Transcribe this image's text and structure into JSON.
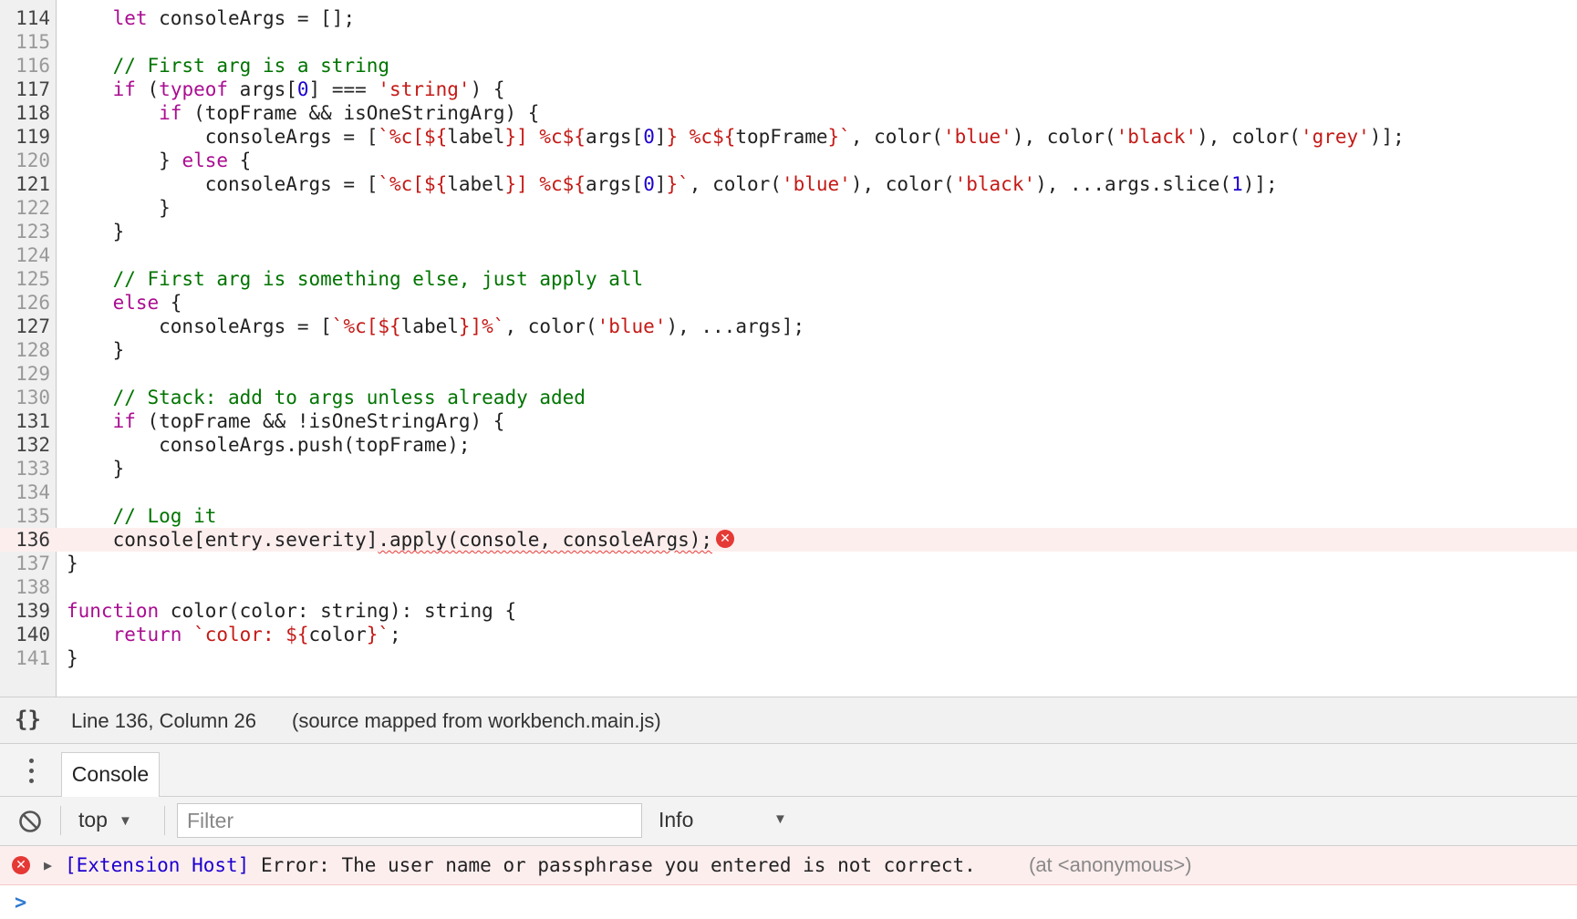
{
  "editor": {
    "current_line": "136",
    "lines": [
      {
        "n": "114",
        "dark": true,
        "t": [
          {
            "c": "",
            "s": "    "
          },
          {
            "c": "kw",
            "s": "let"
          },
          {
            "c": "",
            "s": " consoleArgs = [];"
          }
        ]
      },
      {
        "n": "115",
        "t": []
      },
      {
        "n": "116",
        "t": [
          {
            "c": "",
            "s": "    "
          },
          {
            "c": "cm",
            "s": "// First arg is a string"
          }
        ]
      },
      {
        "n": "117",
        "dark": true,
        "t": [
          {
            "c": "",
            "s": "    "
          },
          {
            "c": "kw",
            "s": "if"
          },
          {
            "c": "",
            "s": " ("
          },
          {
            "c": "kw",
            "s": "typeof"
          },
          {
            "c": "",
            "s": " args["
          },
          {
            "c": "num",
            "s": "0"
          },
          {
            "c": "",
            "s": "] === "
          },
          {
            "c": "str",
            "s": "'string'"
          },
          {
            "c": "",
            "s": ") {"
          }
        ]
      },
      {
        "n": "118",
        "dark": true,
        "t": [
          {
            "c": "",
            "s": "        "
          },
          {
            "c": "kw",
            "s": "if"
          },
          {
            "c": "",
            "s": " (topFrame && isOneStringArg) {"
          }
        ]
      },
      {
        "n": "119",
        "dark": true,
        "t": [
          {
            "c": "",
            "s": "            consoleArgs = ["
          },
          {
            "c": "str",
            "s": "`%c[${"
          },
          {
            "c": "",
            "s": "label"
          },
          {
            "c": "str",
            "s": "}] %c${"
          },
          {
            "c": "",
            "s": "args["
          },
          {
            "c": "num",
            "s": "0"
          },
          {
            "c": "",
            "s": "]"
          },
          {
            "c": "str",
            "s": "} %c${"
          },
          {
            "c": "",
            "s": "topFrame"
          },
          {
            "c": "str",
            "s": "}`"
          },
          {
            "c": "",
            "s": ", color("
          },
          {
            "c": "str",
            "s": "'blue'"
          },
          {
            "c": "",
            "s": "), color("
          },
          {
            "c": "str",
            "s": "'black'"
          },
          {
            "c": "",
            "s": "), color("
          },
          {
            "c": "str",
            "s": "'grey'"
          },
          {
            "c": "",
            "s": ")];"
          }
        ]
      },
      {
        "n": "120",
        "t": [
          {
            "c": "",
            "s": "        } "
          },
          {
            "c": "kw",
            "s": "else"
          },
          {
            "c": "",
            "s": " {"
          }
        ]
      },
      {
        "n": "121",
        "dark": true,
        "t": [
          {
            "c": "",
            "s": "            consoleArgs = ["
          },
          {
            "c": "str",
            "s": "`%c[${"
          },
          {
            "c": "",
            "s": "label"
          },
          {
            "c": "str",
            "s": "}] %c${"
          },
          {
            "c": "",
            "s": "args["
          },
          {
            "c": "num",
            "s": "0"
          },
          {
            "c": "",
            "s": "]"
          },
          {
            "c": "str",
            "s": "}`"
          },
          {
            "c": "",
            "s": ", color("
          },
          {
            "c": "str",
            "s": "'blue'"
          },
          {
            "c": "",
            "s": "), color("
          },
          {
            "c": "str",
            "s": "'black'"
          },
          {
            "c": "",
            "s": "), ...args.slice("
          },
          {
            "c": "num",
            "s": "1"
          },
          {
            "c": "",
            "s": ")];"
          }
        ]
      },
      {
        "n": "122",
        "t": [
          {
            "c": "",
            "s": "        }"
          }
        ]
      },
      {
        "n": "123",
        "t": [
          {
            "c": "",
            "s": "    }"
          }
        ]
      },
      {
        "n": "124",
        "t": []
      },
      {
        "n": "125",
        "t": [
          {
            "c": "",
            "s": "    "
          },
          {
            "c": "cm",
            "s": "// First arg is something else, just apply all"
          }
        ]
      },
      {
        "n": "126",
        "t": [
          {
            "c": "",
            "s": "    "
          },
          {
            "c": "kw",
            "s": "else"
          },
          {
            "c": "",
            "s": " {"
          }
        ]
      },
      {
        "n": "127",
        "dark": true,
        "t": [
          {
            "c": "",
            "s": "        consoleArgs = ["
          },
          {
            "c": "str",
            "s": "`%c[${"
          },
          {
            "c": "",
            "s": "label"
          },
          {
            "c": "str",
            "s": "}]%`"
          },
          {
            "c": "",
            "s": ", color("
          },
          {
            "c": "str",
            "s": "'blue'"
          },
          {
            "c": "",
            "s": "), ...args];"
          }
        ]
      },
      {
        "n": "128",
        "t": [
          {
            "c": "",
            "s": "    }"
          }
        ]
      },
      {
        "n": "129",
        "t": []
      },
      {
        "n": "130",
        "t": [
          {
            "c": "",
            "s": "    "
          },
          {
            "c": "cm",
            "s": "// Stack: add to args unless already aded"
          }
        ]
      },
      {
        "n": "131",
        "dark": true,
        "t": [
          {
            "c": "",
            "s": "    "
          },
          {
            "c": "kw",
            "s": "if"
          },
          {
            "c": "",
            "s": " (topFrame && !isOneStringArg) {"
          }
        ]
      },
      {
        "n": "132",
        "dark": true,
        "t": [
          {
            "c": "",
            "s": "        consoleArgs.push(topFrame);"
          }
        ]
      },
      {
        "n": "133",
        "t": [
          {
            "c": "",
            "s": "    }"
          }
        ]
      },
      {
        "n": "134",
        "t": []
      },
      {
        "n": "135",
        "t": [
          {
            "c": "",
            "s": "    "
          },
          {
            "c": "cm",
            "s": "// Log it"
          }
        ]
      },
      {
        "n": "136",
        "dark": true,
        "current": true,
        "error": true,
        "t": [
          {
            "c": "",
            "s": "    console[entry.severity]"
          },
          {
            "c": "squig",
            "s": ".apply(console, consoleArgs);"
          }
        ]
      },
      {
        "n": "137",
        "t": [
          {
            "c": "",
            "s": "}"
          }
        ]
      },
      {
        "n": "138",
        "t": []
      },
      {
        "n": "139",
        "dark": true,
        "t": [
          {
            "c": "kw",
            "s": "function"
          },
          {
            "c": "",
            "s": " color(color: string): string {"
          }
        ]
      },
      {
        "n": "140",
        "dark": true,
        "t": [
          {
            "c": "",
            "s": "    "
          },
          {
            "c": "kw",
            "s": "return"
          },
          {
            "c": "",
            "s": " "
          },
          {
            "c": "str",
            "s": "`color: ${"
          },
          {
            "c": "",
            "s": "color"
          },
          {
            "c": "str",
            "s": "}`"
          },
          {
            "c": "",
            "s": ";"
          }
        ]
      },
      {
        "n": "141",
        "t": [
          {
            "c": "",
            "s": "}"
          }
        ]
      }
    ]
  },
  "statusbar": {
    "pretty_print_label": "{}",
    "cursor_position": "Line 136, Column 26",
    "source_map": "(source mapped from workbench.main.js)"
  },
  "drawer": {
    "tab_label": "Console"
  },
  "console": {
    "context_label": "top",
    "filter_placeholder": "Filter",
    "level_label": "Info",
    "error": {
      "prefix": "[Extension Host]",
      "message": " Error: The user name or passphrase you entered is not correct.",
      "location": "(at <anonymous>)"
    },
    "prompt": ">"
  },
  "icons": {
    "error": "error-icon",
    "clear": "clear-console-icon",
    "expand": "expand-triangle-icon",
    "menu": "more-vertical-icon"
  },
  "colors": {
    "error_red": "#e53935",
    "keyword": "#aa0d91",
    "string": "#c41a16",
    "comment": "#007400",
    "number": "#1c00cf"
  }
}
